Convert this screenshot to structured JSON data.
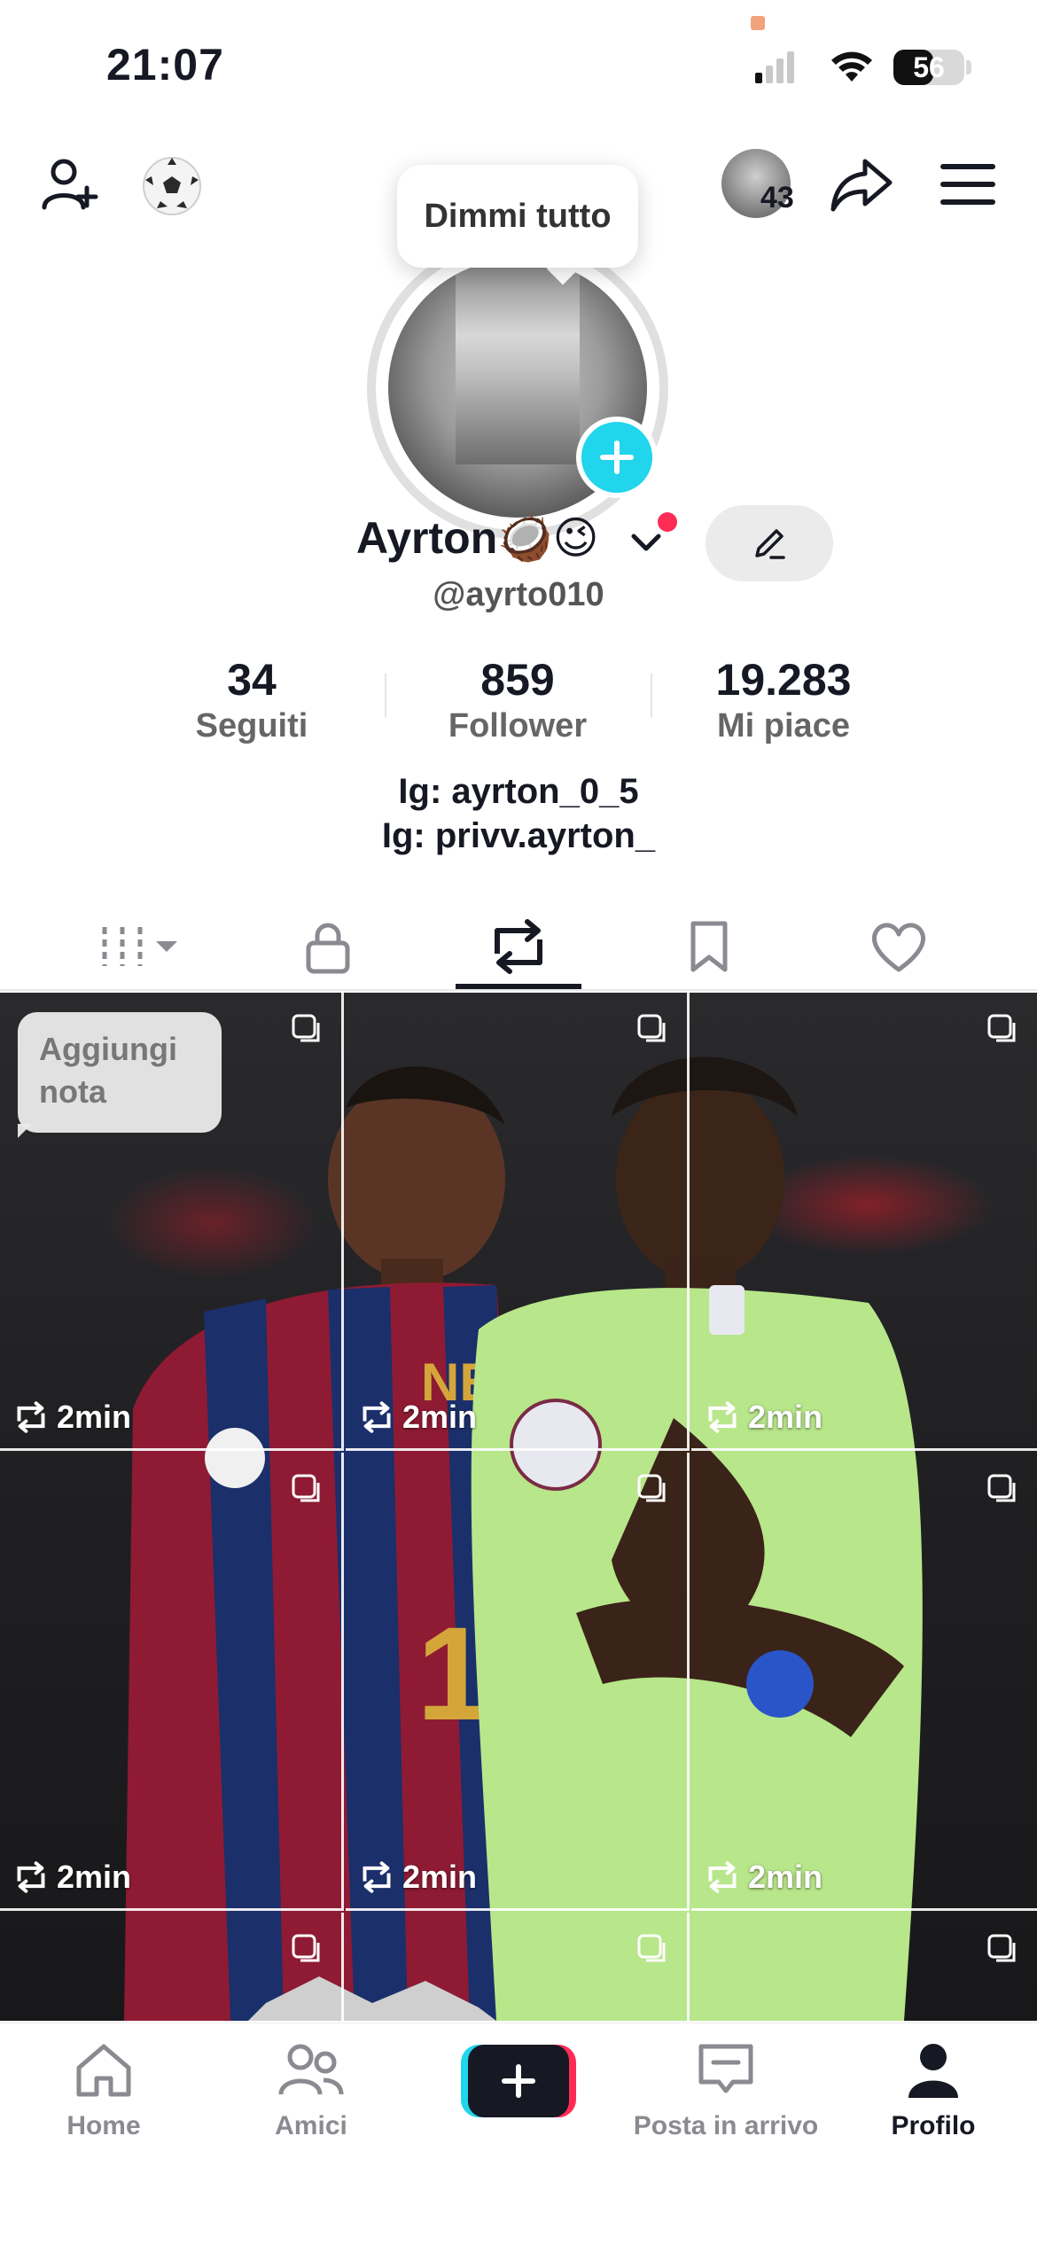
{
  "status_bar": {
    "time": "21:07",
    "battery": "56",
    "battery_level": 0.56
  },
  "header": {
    "tooltip": "Dimmi tutto",
    "friends_count": "43"
  },
  "profile": {
    "name": "Ayrton🥥😉",
    "handle": "@ayrto010",
    "stats": [
      {
        "value": "34",
        "label": "Seguiti"
      },
      {
        "value": "859",
        "label": "Follower"
      },
      {
        "value": "19.283",
        "label": "Mi piace"
      }
    ],
    "bio": [
      "Ig: ayrton_0_5",
      "Ig: privv.ayrton_"
    ]
  },
  "tabs": [
    {
      "icon": "grid-filter-icon",
      "active": false
    },
    {
      "icon": "lock-icon",
      "active": false
    },
    {
      "icon": "repost-icon",
      "active": true
    },
    {
      "icon": "bookmark-icon",
      "active": false
    },
    {
      "icon": "heart-icon",
      "active": false
    }
  ],
  "grid": {
    "note": "Aggiungi nota",
    "items": [
      {
        "time": "2min"
      },
      {
        "time": "2min"
      },
      {
        "time": "2min"
      },
      {
        "time": "2min"
      },
      {
        "time": "2min"
      },
      {
        "time": "2min"
      }
    ]
  },
  "bottom_nav": [
    {
      "label": "Home",
      "icon": "home-icon"
    },
    {
      "label": "Amici",
      "icon": "friends-icon"
    },
    {
      "label": "",
      "icon": "create-icon"
    },
    {
      "label": "Posta in arrivo",
      "icon": "inbox-icon"
    },
    {
      "label": "Profilo",
      "icon": "profile-icon",
      "active": true
    }
  ],
  "colors": {
    "accent": "#fe2c55",
    "cyan": "#20d5ec",
    "text": "#161823"
  }
}
